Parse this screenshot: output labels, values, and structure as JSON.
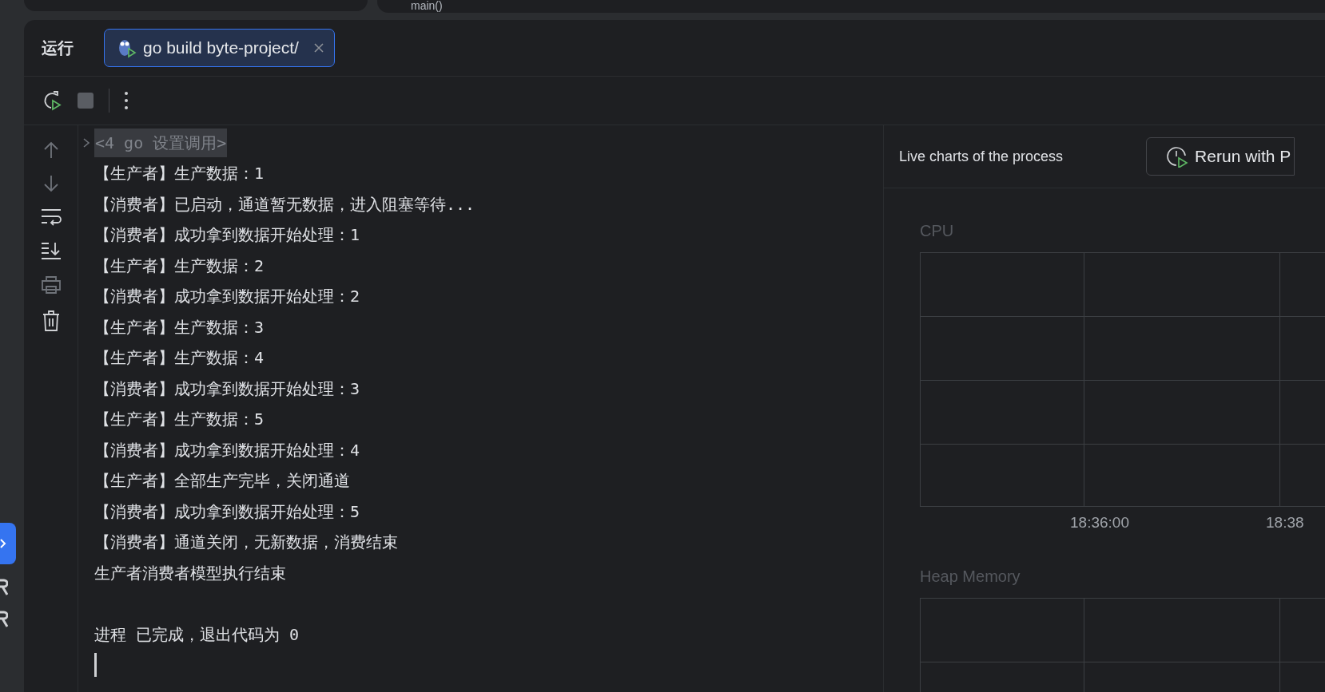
{
  "top_bar": {
    "breadcrumb": "main()"
  },
  "run_panel": {
    "title": "运行",
    "tabs": [
      {
        "label": "go build byte-project/",
        "selected": true
      }
    ]
  },
  "console": {
    "header": "<4 go 设置调用>",
    "lines": [
      "【生产者】生产数据：1",
      "【消费者】已启动，通道暂无数据，进入阻塞等待...",
      "【消费者】成功拿到数据开始处理：1",
      "【生产者】生产数据：2",
      "【消费者】成功拿到数据开始处理：2",
      "【生产者】生产数据：3",
      "【生产者】生产数据：4",
      "【消费者】成功拿到数据开始处理：3",
      "【生产者】生产数据：5",
      "【消费者】成功拿到数据开始处理：4",
      "【生产者】全部生产完毕，关闭通道",
      "【消费者】成功拿到数据开始处理：5",
      "【消费者】通道关闭，无新数据，消费结束",
      "生产者消费者模型执行结束"
    ],
    "exit_message": "进程 已完成，退出代码为 0"
  },
  "live_charts": {
    "title": "Live charts of the process",
    "button": "Rerun with P",
    "charts": [
      {
        "title": "CPU",
        "xticks": [
          "18:36:00",
          "18:38"
        ]
      },
      {
        "title": "Heap Memory"
      }
    ]
  }
}
